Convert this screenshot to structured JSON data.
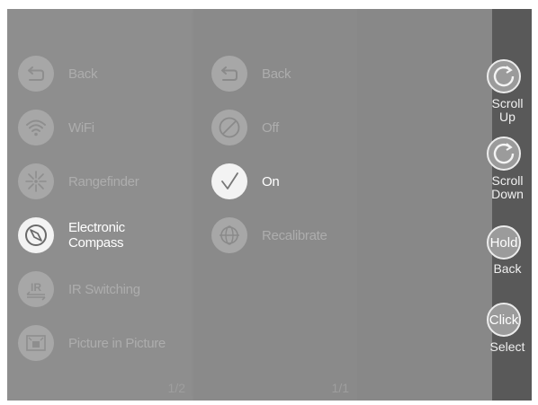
{
  "menu1": {
    "items": [
      {
        "label": "Back",
        "icon": "back-arrow-icon",
        "active": false
      },
      {
        "label": "WiFi",
        "icon": "wifi-icon",
        "active": false
      },
      {
        "label": "Rangefinder",
        "icon": "rangefinder-icon",
        "active": false
      },
      {
        "label": "Electronic\nCompass",
        "icon": "compass-icon",
        "active": true
      },
      {
        "label": "IR Switching",
        "icon": "ir-icon",
        "active": false
      },
      {
        "label": "Picture in Picture",
        "icon": "picture-in-picture-icon",
        "active": false
      }
    ],
    "page": "1/2"
  },
  "menu2": {
    "items": [
      {
        "label": "Back",
        "icon": "back-arrow-icon",
        "active": false
      },
      {
        "label": "Off",
        "icon": "off-icon",
        "active": false
      },
      {
        "label": "On",
        "icon": "checkmark-icon",
        "active": true
      },
      {
        "label": "Recalibrate",
        "icon": "recalibrate-icon",
        "active": false
      }
    ],
    "page": "1/1"
  },
  "controls": {
    "scroll_up": "Scroll\nUp",
    "scroll_down": "Scroll\nDown",
    "hold_button": "Hold",
    "hold_label": "Back",
    "click_button": "Click",
    "click_label": "Select"
  }
}
